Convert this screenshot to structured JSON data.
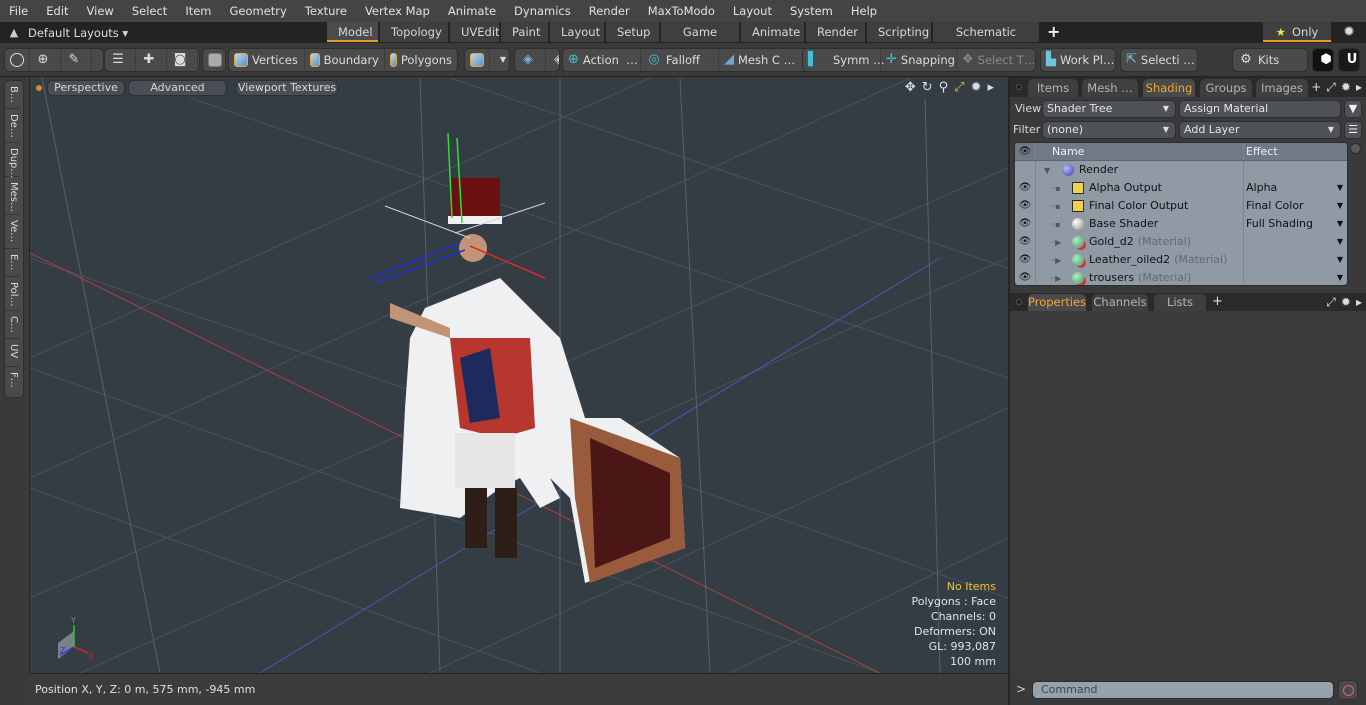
{
  "menubar": {
    "items": [
      "File",
      "Edit",
      "View",
      "Select",
      "Item",
      "Geometry",
      "Texture",
      "Vertex Map",
      "Animate",
      "Dynamics",
      "Render",
      "MaxToModo",
      "Layout",
      "System",
      "Help"
    ]
  },
  "layoutbar": {
    "layout_select": "Default Layouts ▾",
    "tabs": [
      "Model",
      "Topology",
      "UVEdit",
      "Paint",
      "Layout",
      "Setup",
      "Game Tools",
      "Animate",
      "Render",
      "Scripting",
      "Schematic Fusion"
    ],
    "active_tab": "Model",
    "add_tab": "+",
    "only_button": "Only",
    "star_icon": "★",
    "gear_icon": "✹"
  },
  "toolbar": {
    "vertices": "Vertices",
    "boundary": "Boundary",
    "polygons": "Polygons",
    "action": "Action",
    "falloff": "Falloff",
    "mesh_c": "Mesh C …",
    "symm": "Symm …",
    "snapping": "Snapping",
    "select_t": "Select T…",
    "work_pl": "Work Pl…",
    "selecti": "Selecti …",
    "kits": "Kits",
    "ellipsis": "…"
  },
  "left_strip": {
    "tabs": [
      "B…",
      "De…",
      "Dup…",
      "Mes…",
      "Ve…",
      "E…",
      "Pol…",
      "C…",
      "UV",
      "F…"
    ]
  },
  "viewport": {
    "perspective": "Perspective",
    "advanced": "Advanced",
    "viewport_textures": "Viewport Textures",
    "hud": {
      "items": "No Items",
      "polygons": "Polygons : Face",
      "channels": "Channels: 0",
      "deformers": "Deformers: ON",
      "gl": "GL: 993,087",
      "scale": "100 mm"
    },
    "axis_labels": {
      "x": "X",
      "y": "Y",
      "z": "Z"
    }
  },
  "statusbar": {
    "position": "Position X, Y, Z:   0 m, 575 mm, -945 mm"
  },
  "right_panel": {
    "tabs": [
      "Items",
      "Mesh …",
      "Shading",
      "Groups",
      "Images"
    ],
    "active_tab": "Shading",
    "add_tab": "+",
    "view_label": "View",
    "view_value": "Shader Tree",
    "assign_material": "Assign Material",
    "filter_label": "Filter",
    "filter_value": "(none)",
    "add_layer": "Add Layer",
    "tree_headers": {
      "name": "Name",
      "effect": "Effect"
    },
    "tree_rows": [
      {
        "name": "Render",
        "suffix": "",
        "effect": "",
        "icon": "sphere-blue",
        "eye": false,
        "indent": 0,
        "expander": "▼"
      },
      {
        "name": "Alpha Output",
        "suffix": "",
        "effect": "Alpha",
        "icon": "out",
        "eye": true,
        "indent": 1,
        "expander": ""
      },
      {
        "name": "Final Color Output",
        "suffix": "",
        "effect": "Final Color",
        "icon": "out",
        "eye": true,
        "indent": 1,
        "expander": ""
      },
      {
        "name": "Base Shader",
        "suffix": "",
        "effect": "Full Shading",
        "icon": "sphere-white",
        "eye": true,
        "indent": 1,
        "expander": ""
      },
      {
        "name": "Gold_d2",
        "suffix": "(Material)",
        "effect": "",
        "icon": "mat",
        "eye": true,
        "indent": 1,
        "expander": "▶"
      },
      {
        "name": "Leather_oiled2",
        "suffix": "(Material)",
        "effect": "",
        "icon": "mat",
        "eye": true,
        "indent": 1,
        "expander": "▶"
      },
      {
        "name": "trousers",
        "suffix": "(Material)",
        "effect": "",
        "icon": "mat",
        "eye": true,
        "indent": 1,
        "expander": "▶"
      }
    ],
    "bottom_tabs": [
      "Properties",
      "Channels",
      "Lists"
    ],
    "bottom_active": "Properties"
  },
  "command": {
    "prompt": ">",
    "placeholder": "Command"
  },
  "colors": {
    "accent": "#e89b2d",
    "hud_warning": "#f0c23b",
    "tab_active_text": "#f0a53a"
  }
}
